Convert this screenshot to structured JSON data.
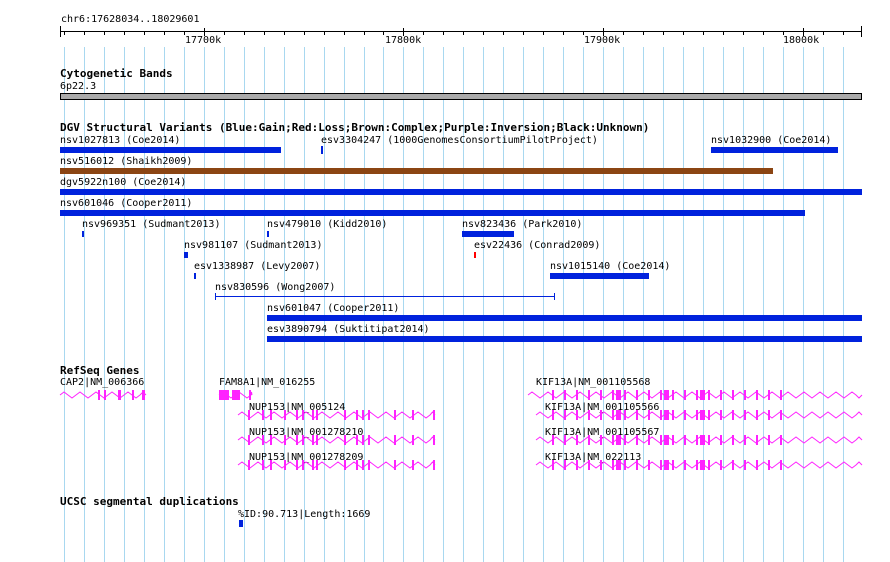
{
  "region": "chr6:17628034..18029601",
  "ticks": [
    {
      "pos": 17700000,
      "label": "17700k"
    },
    {
      "pos": 17800000,
      "label": "17800k"
    },
    {
      "pos": 17900000,
      "label": "17900k"
    },
    {
      "pos": 18000000,
      "label": "18000k"
    }
  ],
  "tracks": {
    "cyto": {
      "title": "Cytogenetic Bands",
      "band": "6p22.3"
    },
    "dgv": {
      "title": "DGV Structural Variants (Blue:Gain;Red:Loss;Brown:Complex;Purple:Inversion;Black:Unknown)",
      "colors": {
        "gain": "#0022dd",
        "loss": "#ff0000",
        "complex": "#8b4513"
      },
      "variants": [
        {
          "label": "nsv1027813 (Coe2014)",
          "type": "gain"
        },
        {
          "label": "esv3304247 (1000GenomesConsortiumPilotProject)",
          "type": "gain"
        },
        {
          "label": "nsv1032900 (Coe2014)",
          "type": "gain"
        },
        {
          "label": "nsv516012 (Shaikh2009)",
          "type": "complex"
        },
        {
          "label": "dgv5922n100 (Coe2014)",
          "type": "gain"
        },
        {
          "label": "nsv601046 (Cooper2011)",
          "type": "gain"
        },
        {
          "label": "nsv969351 (Sudmant2013)",
          "type": "gain"
        },
        {
          "label": "nsv479010 (Kidd2010)",
          "type": "gain"
        },
        {
          "label": "nsv823436 (Park2010)",
          "type": "gain"
        },
        {
          "label": "nsv981107 (Sudmant2013)",
          "type": "gain"
        },
        {
          "label": "esv22436 (Conrad2009)",
          "type": "loss"
        },
        {
          "label": "esv1338987 (Levy2007)",
          "type": "gain"
        },
        {
          "label": "nsv1015140 (Coe2014)",
          "type": "gain"
        },
        {
          "label": "nsv830596 (Wong2007)",
          "type": "gain"
        },
        {
          "label": "nsv601047 (Cooper2011)",
          "type": "gain"
        },
        {
          "label": "esv3890794 (Suktitipat2014)",
          "type": "gain"
        }
      ]
    },
    "refseq": {
      "title": "RefSeq Genes",
      "color": "#ff22ff",
      "genes": [
        {
          "label": "CAP2|NM_006366"
        },
        {
          "label": "FAM8A1|NM_016255"
        },
        {
          "label": "NUP153|NM_005124"
        },
        {
          "label": "NUP153|NM_001278210"
        },
        {
          "label": "NUP153|NM_001278209"
        },
        {
          "label": "KIF13A|NM_001105568"
        },
        {
          "label": "KIF13A|NM_001105566"
        },
        {
          "label": "KIF13A|NM_001105567"
        },
        {
          "label": "KIF13A|NM_022113"
        }
      ]
    },
    "segdup": {
      "title": "UCSC segmental duplications",
      "items": [
        {
          "label": "%ID:90.713|Length:1669"
        }
      ]
    }
  }
}
